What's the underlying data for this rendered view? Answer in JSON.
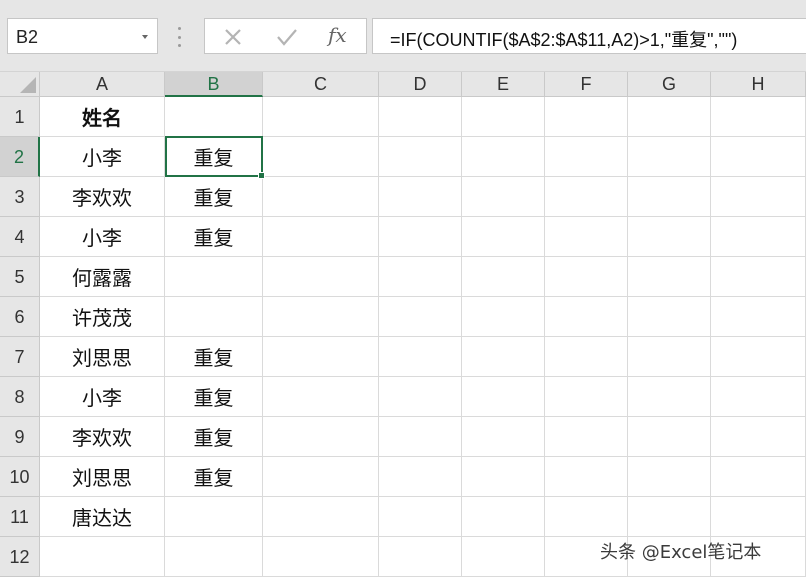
{
  "formula_bar": {
    "name_box": "B2",
    "cancel_icon": "x-icon",
    "enter_icon": "check-icon",
    "insert_function_label": "fx",
    "formula": "=IF(COUNTIF($A$2:$A$11,A2)>1,\"重复\",\"\")"
  },
  "grid": {
    "columns": [
      "A",
      "B",
      "C",
      "D",
      "E",
      "F",
      "G",
      "H"
    ],
    "selected_column": "B",
    "selected_row": "2",
    "selected_cell": "B2",
    "rows": [
      {
        "num": "1",
        "a": "姓名",
        "b": ""
      },
      {
        "num": "2",
        "a": "小李",
        "b": "重复"
      },
      {
        "num": "3",
        "a": "李欢欢",
        "b": "重复"
      },
      {
        "num": "4",
        "a": "小李",
        "b": "重复"
      },
      {
        "num": "5",
        "a": "何露露",
        "b": ""
      },
      {
        "num": "6",
        "a": "许茂茂",
        "b": ""
      },
      {
        "num": "7",
        "a": "刘思思",
        "b": "重复"
      },
      {
        "num": "8",
        "a": "小李",
        "b": "重复"
      },
      {
        "num": "9",
        "a": "李欢欢",
        "b": "重复"
      },
      {
        "num": "10",
        "a": "刘思思",
        "b": "重复"
      },
      {
        "num": "11",
        "a": "唐达达",
        "b": ""
      },
      {
        "num": "12",
        "a": "",
        "b": ""
      }
    ]
  },
  "watermark": "头条 @Excel笔记本",
  "colors": {
    "accent": "#217346",
    "header_bg": "#e6e6e6",
    "gridline": "#dadada"
  }
}
